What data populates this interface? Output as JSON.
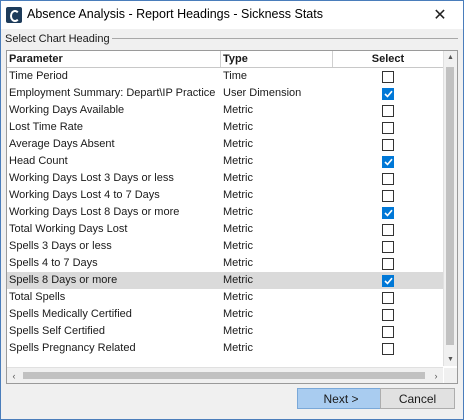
{
  "window": {
    "title": "Absence Analysis - Report Headings  - Sickness Stats",
    "close_glyph": "✕"
  },
  "group": {
    "label": "Select Chart Heading"
  },
  "grid": {
    "columns": {
      "parameter": "Parameter",
      "type": "Type",
      "select": "Select"
    },
    "rows": [
      {
        "parameter": "Time Period",
        "type": "Time",
        "selected": false
      },
      {
        "parameter": "Employment Summary: Depart\\IP Practice",
        "type": "User Dimension",
        "selected": true
      },
      {
        "parameter": "Working Days Available",
        "type": "Metric",
        "selected": false
      },
      {
        "parameter": "Lost Time Rate",
        "type": "Metric",
        "selected": false
      },
      {
        "parameter": "Average Days Absent",
        "type": "Metric",
        "selected": false
      },
      {
        "parameter": "Head Count",
        "type": "Metric",
        "selected": true
      },
      {
        "parameter": "Working Days Lost 3 Days or less",
        "type": "Metric",
        "selected": false
      },
      {
        "parameter": "Working Days Lost 4 to 7 Days",
        "type": "Metric",
        "selected": false
      },
      {
        "parameter": "Working Days Lost 8 Days or more",
        "type": "Metric",
        "selected": true
      },
      {
        "parameter": "Total Working Days Lost",
        "type": "Metric",
        "selected": false
      },
      {
        "parameter": "Spells 3 Days or less",
        "type": "Metric",
        "selected": false
      },
      {
        "parameter": "Spells 4 to 7 Days",
        "type": "Metric",
        "selected": false
      },
      {
        "parameter": "Spells 8 Days or more",
        "type": "Metric",
        "selected": true,
        "highlighted": true
      },
      {
        "parameter": "Total Spells",
        "type": "Metric",
        "selected": false
      },
      {
        "parameter": "Spells Medically Certified",
        "type": "Metric",
        "selected": false
      },
      {
        "parameter": "Spells Self Certified",
        "type": "Metric",
        "selected": false
      },
      {
        "parameter": "Spells Pregnancy Related",
        "type": "Metric",
        "selected": false
      }
    ]
  },
  "buttons": {
    "next": "Next >",
    "cancel": "Cancel"
  },
  "colors": {
    "checkbox_checked": "#0078d7",
    "row_highlight": "#dadada",
    "next_button": "#a9ccf0"
  }
}
